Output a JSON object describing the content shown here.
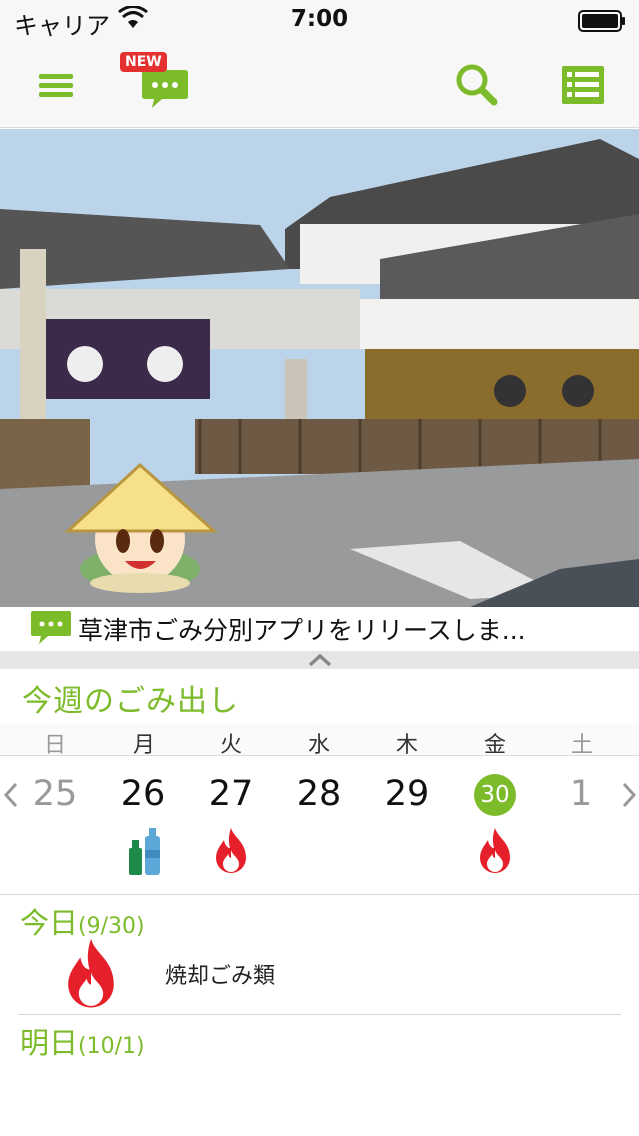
{
  "status_bar": {
    "carrier": "キャリア",
    "time": "7:00"
  },
  "nav": {
    "new_badge": "NEW"
  },
  "news": {
    "text": "草津市ごみ分別アプリをリリースしま..."
  },
  "week": {
    "title": "今週のごみ出し",
    "weekdays": [
      "日",
      "月",
      "火",
      "水",
      "木",
      "金",
      "土"
    ],
    "dates": [
      "25",
      "26",
      "27",
      "28",
      "29",
      "30",
      "1"
    ],
    "today_index": 5
  },
  "today": {
    "label": "今日",
    "date": "(9/30)",
    "items": [
      {
        "label": "焼却ごみ類",
        "icon": "fire-icon"
      }
    ]
  },
  "tomorrow": {
    "label": "明日",
    "date": "(10/1)"
  },
  "colors": {
    "accent": "#7cbb2a",
    "fire": "#e5202b",
    "badge": "#e53030"
  }
}
